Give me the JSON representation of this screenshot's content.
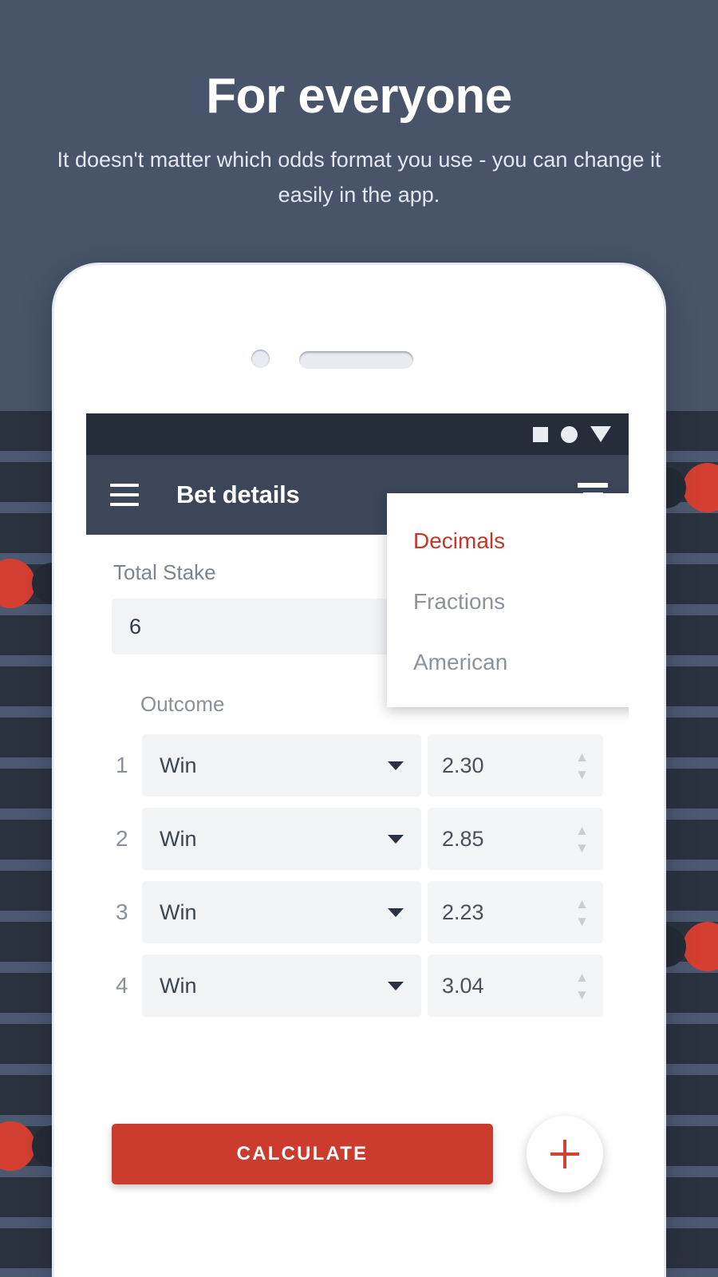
{
  "hero": {
    "title": "For everyone",
    "subtitle": "It doesn't matter which odds format you use - you can change it easily in the app."
  },
  "colors": {
    "page_background": "#475469",
    "appbar": "#3b4659",
    "statusbar": "#262d3a",
    "accent_red": "#cc3c2e",
    "selected_menu_red": "#c0392b",
    "field_gray": "#f2f3f5",
    "pattern_dark": "#2b323f",
    "pattern_light": "#4c5971"
  },
  "statusbar": {
    "icons": [
      "square-icon",
      "circle-icon",
      "triangle-down-icon"
    ]
  },
  "appbar": {
    "menu_icon": "hamburger-menu-icon",
    "title": "Bet details",
    "action_icon": "filter-icon"
  },
  "form": {
    "stake_label": "Total Stake",
    "stake_value": "6",
    "outcome_label": "Outcome"
  },
  "bets": [
    {
      "index": "1",
      "outcome": "Win",
      "odds": "2.30"
    },
    {
      "index": "2",
      "outcome": "Win",
      "odds": "2.85"
    },
    {
      "index": "3",
      "outcome": "Win",
      "odds": "2.23"
    },
    {
      "index": "4",
      "outcome": "Win",
      "odds": "3.04"
    }
  ],
  "actions": {
    "calculate_label": "CALCULATE",
    "fab_icon": "plus-icon"
  },
  "dropdown": {
    "items": [
      {
        "label": "Decimals",
        "selected": true
      },
      {
        "label": "Fractions",
        "selected": false
      },
      {
        "label": "American",
        "selected": false
      }
    ]
  }
}
